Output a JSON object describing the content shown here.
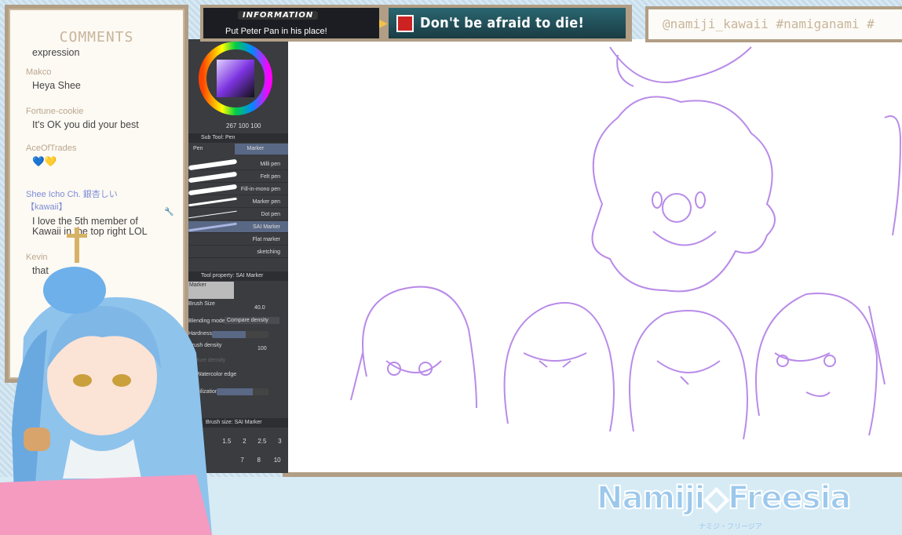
{
  "comments": {
    "title": "COMMENTS",
    "messages": [
      {
        "name": "",
        "text": "expression"
      },
      {
        "name": "Makco",
        "text": "Heya Shee"
      },
      {
        "name": "Fortune-cookie",
        "text": "It's OK you did your best"
      },
      {
        "name": "AceOfTrades",
        "text": "💙💛"
      },
      {
        "name": "Shee Icho Ch. 銀杏しい【kawaii】",
        "text": "I love the 5th member of Kawaii in the top right LOL",
        "moderator": true
      },
      {
        "name": "Kevin",
        "text": "that"
      }
    ]
  },
  "info": {
    "label": "INFORMATION",
    "text": "Put Peter Pan in his place!"
  },
  "banner": {
    "text": "Don't be afraid to die!"
  },
  "social": {
    "text": "@namiji_kawaii #namiganami #"
  },
  "csp": {
    "color_values": "267  100  100",
    "subtool_header": "Sub Tool: Pen",
    "tabs": [
      "Pen",
      "Marker"
    ],
    "brushes": [
      "Milli pen",
      "Felt pen",
      "Fill-in-mono pen",
      "Marker pen",
      "Dot pen",
      "SAI Marker",
      "Flat marker",
      "sketching"
    ],
    "selected_brush": "SAI Marker",
    "tool_property_header": "Tool property: SAI Marker",
    "preview_label": "Marker",
    "brush_size_label": "Brush Size",
    "brush_size": "40.0",
    "blending_label": "Blending mode",
    "blending_value": "Compare density",
    "hardness_label": "Hardness",
    "density_label": "Brush density",
    "density": "100",
    "texture_label": "Texture density",
    "watercolor_label": "Watercolor edge",
    "stabilization_label": "Stabilization",
    "brush_size_header": "Brush size: SAI Marker",
    "sizes": [
      "1.5",
      "2",
      "2.5",
      "3",
      "7",
      "8",
      "10"
    ]
  },
  "logo": {
    "text": "Namiji◇Freesia",
    "sub": "ナミジ・フリージア"
  },
  "colors": {
    "frame": "#b19e85",
    "sketch": "#b98be8"
  }
}
